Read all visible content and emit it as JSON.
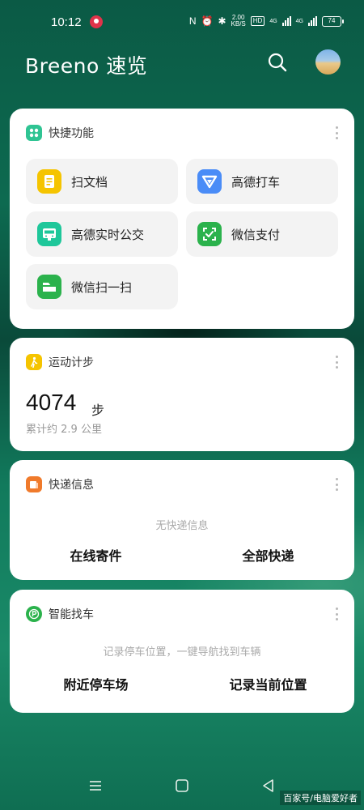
{
  "status": {
    "time": "10:12",
    "speed_top": "2.00",
    "speed_bottom": "KB/S",
    "hd": "HD",
    "net1": "4G",
    "net2": "4G",
    "battery": "74"
  },
  "header": {
    "title": "Breeno 速览"
  },
  "shortcuts": {
    "title": "快捷功能",
    "items": [
      {
        "label": "扫文档",
        "icon": "document-scan-icon",
        "color": "#f5c400"
      },
      {
        "label": "高德打车",
        "icon": "amap-taxi-icon",
        "color": "#4a8cf7"
      },
      {
        "label": "高德实时公交",
        "icon": "bus-icon",
        "color": "#1ec79a"
      },
      {
        "label": "微信支付",
        "icon": "wechat-pay-icon",
        "color": "#2bb24c"
      },
      {
        "label": "微信扫一扫",
        "icon": "wechat-scan-icon",
        "color": "#2bb24c"
      }
    ]
  },
  "steps": {
    "title": "运动计步",
    "count": "4074",
    "unit": "步",
    "distance": "累计约 2.9 公里",
    "icon_color": "#f5c400"
  },
  "express": {
    "title": "快递信息",
    "empty": "无快递信息",
    "action_left": "在线寄件",
    "action_right": "全部快递",
    "icon_color": "#f07a2b"
  },
  "parking": {
    "title": "智能找车",
    "hint": "记录停车位置，一键导航找到车辆",
    "action_left": "附近停车场",
    "action_right": "记录当前位置",
    "icon_color": "#2bb24c"
  },
  "watermark": "百家号/电脑爱好者"
}
